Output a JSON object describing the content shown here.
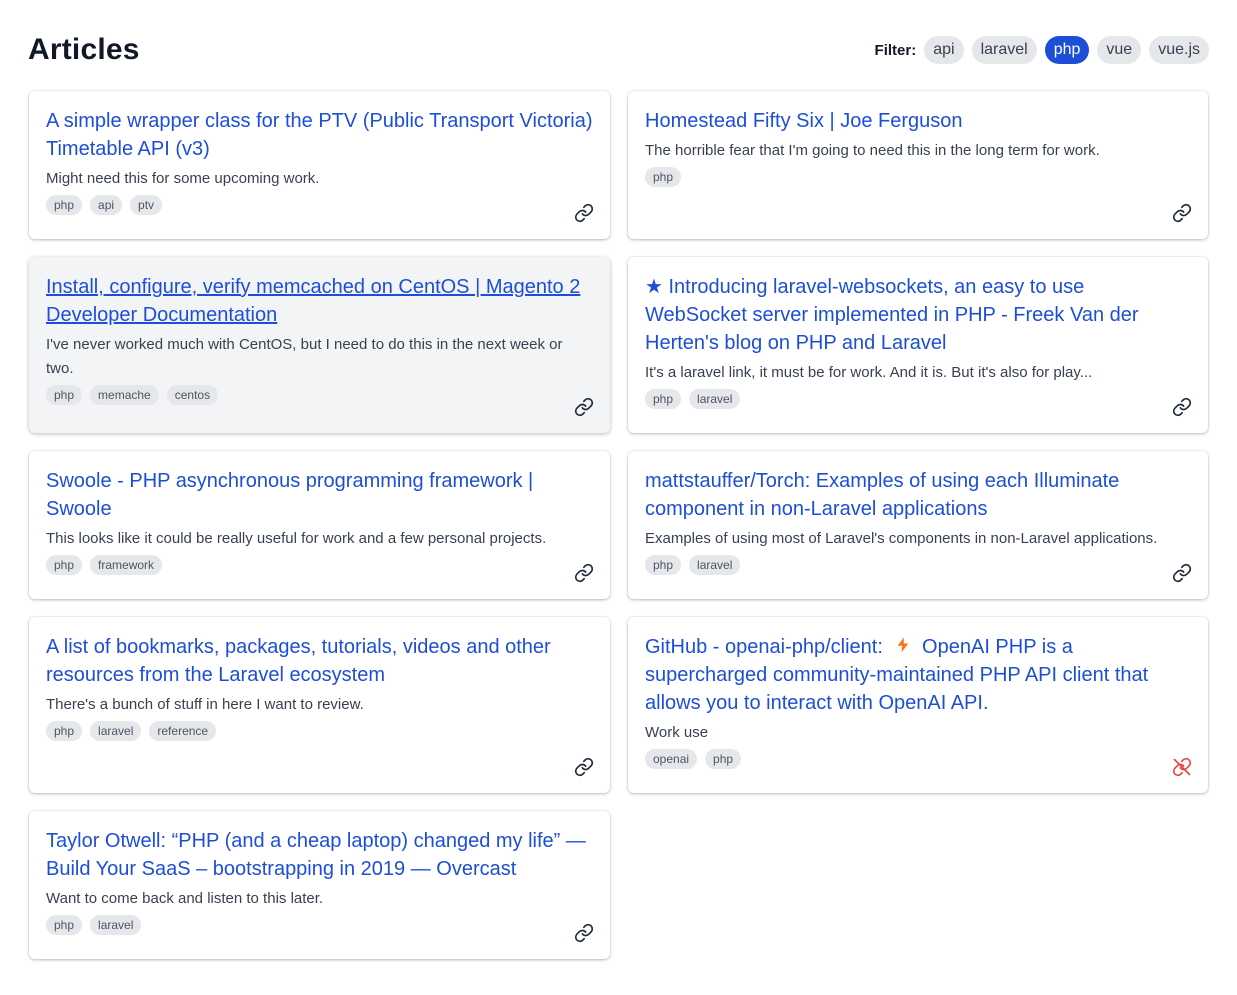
{
  "page": {
    "title": "Articles",
    "filter_label": "Filter:",
    "filters": [
      "api",
      "laravel",
      "php",
      "vue",
      "vue.js"
    ],
    "active_filter": "php"
  },
  "colors": {
    "accent": "#1d4ed8",
    "tag_bg": "#e5e7eb",
    "broken_link": "#ef4444",
    "bolt": "#f97316"
  },
  "articles": [
    {
      "title": "A simple wrapper class for the PTV (Public Transport Victoria) Timetable API (v3)",
      "description": "Might need this for some upcoming work.",
      "tags": [
        "php",
        "api",
        "ptv"
      ],
      "link_icon": "link-icon"
    },
    {
      "title": "Homestead Fifty Six | Joe Ferguson",
      "description": "The horrible fear that I'm going to need this in the long term for work.",
      "tags": [
        "php"
      ],
      "link_icon": "link-icon"
    },
    {
      "title": "Install, configure, verify memcached on CentOS | Magento 2 Developer Documentation",
      "description": "I've never worked much with CentOS, but I need to do this in the next week or two.",
      "tags": [
        "php",
        "memache",
        "centos"
      ],
      "link_icon": "link-icon"
    },
    {
      "title": "★ Introducing laravel-websockets, an easy to use WebSocket server implemented in PHP - Freek Van der Herten's blog on PHP and Laravel",
      "description": "It's a laravel link, it must be for work. And it is. But it's also for play...",
      "tags": [
        "php",
        "laravel"
      ],
      "link_icon": "link-icon"
    },
    {
      "title": "Swoole - PHP asynchronous programming framework | Swoole",
      "description": "This looks like it could be really useful for work and a few personal projects.",
      "tags": [
        "php",
        "framework"
      ],
      "link_icon": "link-icon"
    },
    {
      "title": "mattstauffer/Torch: Examples of using each Illuminate component in non-Laravel applications",
      "description": "Examples of using most of Laravel's components in non-Laravel applications.",
      "tags": [
        "php",
        "laravel"
      ],
      "link_icon": "link-icon"
    },
    {
      "title": "A list of bookmarks, packages, tutorials, videos and other resources from the Laravel ecosystem",
      "description": "There's a bunch of stuff in here I want to review.",
      "tags": [
        "php",
        "laravel",
        "reference"
      ],
      "link_icon": "link-icon"
    },
    {
      "title_prefix": "GitHub - openai-php/client:",
      "title_suffix": "OpenAI PHP is a supercharged community-maintained PHP API client that allows you to interact with OpenAI API.",
      "title_icon": "lightning-bolt-icon",
      "description": "Work use",
      "tags": [
        "openai",
        "php"
      ],
      "link_icon": "broken-link-icon"
    },
    {
      "title": "Taylor Otwell: “PHP (and a cheap laptop) changed my life” — Build Your SaaS – bootstrapping in 2019 — Overcast",
      "description": "Want to come back and listen to this later.",
      "tags": [
        "php",
        "laravel"
      ],
      "link_icon": "link-icon"
    }
  ]
}
